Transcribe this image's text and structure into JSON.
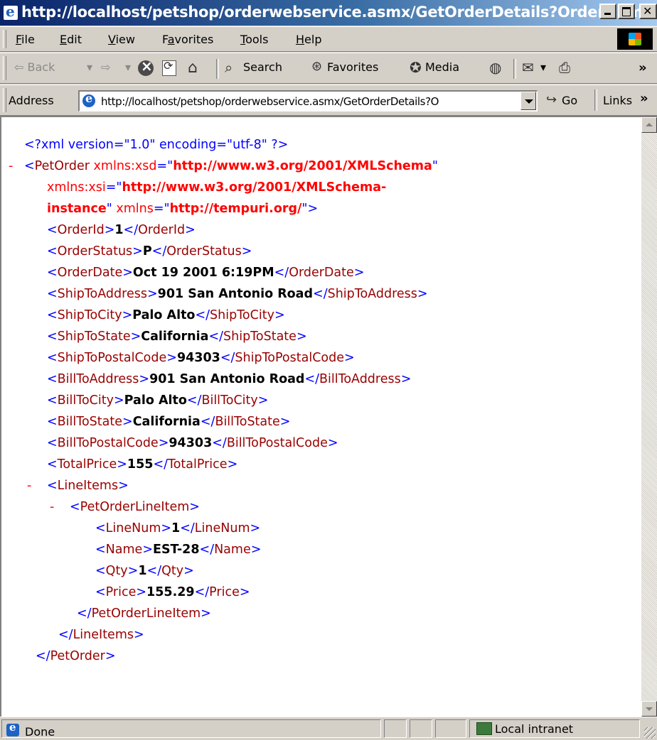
{
  "window": {
    "title": "http://localhost/petshop/orderwebservice.asmx/GetOrderDetails?OrderNum..."
  },
  "menu": {
    "items": [
      "File",
      "Edit",
      "View",
      "Favorites",
      "Tools",
      "Help"
    ],
    "accents": [
      "F",
      "E",
      "V",
      "a",
      "T",
      "H"
    ]
  },
  "toolbar": {
    "back": "⇦ Back",
    "forward": "⇨",
    "search": "Search",
    "favorites": "Favorites",
    "media": "Media"
  },
  "address": {
    "label": "Address",
    "url": "http://localhost/petshop/orderwebservice.asmx/GetOrderDetails?O",
    "go": "Go",
    "links": "Links"
  },
  "xml": {
    "declaration": "<?xml version=\"1.0\" encoding=\"utf-8\" ?>",
    "root": {
      "name": "PetOrder",
      "attrs": [
        {
          "name": "xmlns:xsd",
          "value": "http://www.w3.org/2001/XMLSchema"
        },
        {
          "name": "xmlns:xsi",
          "value": "http://www.w3.org/2001/XMLSchema-instance",
          "value_line1": "http://www.w3.org/2001/XMLSchema-",
          "value_line2": "instance"
        },
        {
          "name": "xmlns",
          "value": "http://tempuri.org/"
        }
      ]
    },
    "fields": [
      {
        "tag": "OrderId",
        "value": "1"
      },
      {
        "tag": "OrderStatus",
        "value": "P"
      },
      {
        "tag": "OrderDate",
        "value": "Oct 19 2001 6:19PM"
      },
      {
        "tag": "ShipToAddress",
        "value": "901 San Antonio Road"
      },
      {
        "tag": "ShipToCity",
        "value": "Palo Alto"
      },
      {
        "tag": "ShipToState",
        "value": "California"
      },
      {
        "tag": "ShipToPostalCode",
        "value": "94303"
      },
      {
        "tag": "BillToAddress",
        "value": "901 San Antonio Road"
      },
      {
        "tag": "BillToCity",
        "value": "Palo Alto"
      },
      {
        "tag": "BillToState",
        "value": "California"
      },
      {
        "tag": "BillToPostalCode",
        "value": "94303"
      },
      {
        "tag": "TotalPrice",
        "value": "155"
      }
    ],
    "line_items_tag": "LineItems",
    "line_item_tag": "PetOrderLineItem",
    "line_item_fields": [
      {
        "tag": "LineNum",
        "value": "1"
      },
      {
        "tag": "Name",
        "value": "EST-28"
      },
      {
        "tag": "Qty",
        "value": "1"
      },
      {
        "tag": "Price",
        "value": "155.29"
      }
    ],
    "collapse_glyph": "-"
  },
  "status": {
    "text": "Done",
    "zone": "Local intranet"
  },
  "colors": {
    "markup": "#0000ff",
    "tag_name": "#990000",
    "attr_value": "#ff0000",
    "title_bar": "#0a246a"
  }
}
